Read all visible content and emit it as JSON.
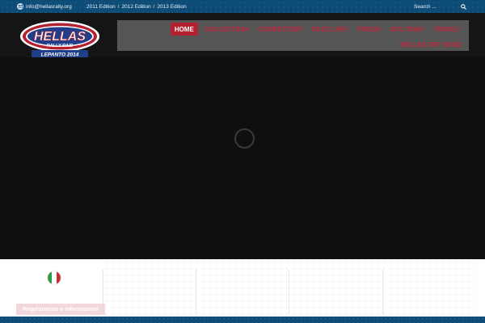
{
  "topbar": {
    "email": "info@hellasrally.org",
    "editions": [
      "2011 Edition",
      "2012 Edition",
      "2013 Edition"
    ],
    "separator": "/",
    "search_placeholder": "Search ..."
  },
  "logo": {
    "word": "HELLAS",
    "subtitle": "RALLY RAID",
    "edition": "LEPANTO 2014"
  },
  "nav": {
    "items": [
      {
        "label": "HOME",
        "active": true,
        "dropdown": false
      },
      {
        "label": "2014 EDITION",
        "active": false,
        "dropdown": true
      },
      {
        "label": "COMPETITOR",
        "active": false,
        "dropdown": true
      },
      {
        "label": "RACE LIVE",
        "active": false,
        "dropdown": true
      },
      {
        "label": "PRESS",
        "active": false,
        "dropdown": true
      },
      {
        "label": "ADV. RAID",
        "active": false,
        "dropdown": true
      },
      {
        "label": "TRAVEL",
        "active": false,
        "dropdown": true
      }
    ],
    "second_row": {
      "label": "HELLAS OFF ROAD"
    },
    "caret": "▾"
  },
  "lower": {
    "button_label": "Regolamento e informazioni",
    "flag": "italy-flag"
  },
  "colors": {
    "topbar": "#0d4c77",
    "nav_text": "#c0283c",
    "active_bg": "#b3202f",
    "nav_panel": "#555555"
  }
}
